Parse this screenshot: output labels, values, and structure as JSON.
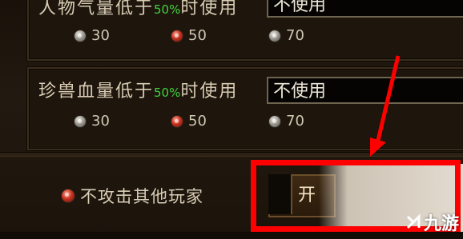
{
  "rows": [
    {
      "label_pre": "人物气量低于",
      "percent": "50%",
      "label_post": "时使用",
      "select_value": "不使用",
      "options": [
        "30",
        "50",
        "70"
      ],
      "selected_index": 1
    },
    {
      "label_pre": "珍兽血量低于",
      "percent": "50%",
      "label_post": "时使用",
      "select_value": "不使用",
      "options": [
        "30",
        "50",
        "70"
      ],
      "selected_index": 1
    }
  ],
  "no_attack_label": "不攻击其他玩家",
  "start_button_label": "开",
  "watermark_text": "九游",
  "colors": {
    "percent_green": "#3fd33f",
    "highlight_red": "#ff0000"
  }
}
